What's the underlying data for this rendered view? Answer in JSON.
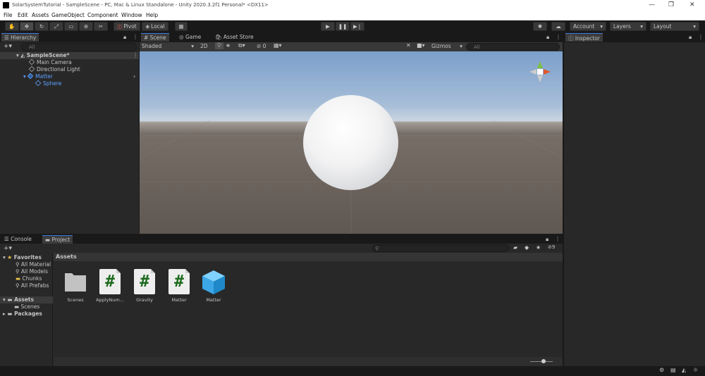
{
  "window": {
    "title": "SolarSystemTutorial - SampleScene - PC, Mac & Linux Standalone - Unity 2020.3.2f1 Personal* <DX11>",
    "minimize": "—",
    "maximize": "❐",
    "close": "✕"
  },
  "menu": [
    "File",
    "Edit",
    "Assets",
    "GameObject",
    "Component",
    "Window",
    "Help"
  ],
  "toolbar": {
    "pivot": "Pivot",
    "local": "Local",
    "account": "Account",
    "layers": "Layers",
    "layout": "Layout"
  },
  "hierarchy": {
    "tab": "Hierarchy",
    "search_placeholder": "All",
    "scene": "SampleScene*",
    "items": [
      "Main Camera",
      "Directional Light",
      "Matter",
      "Sphere"
    ]
  },
  "scene": {
    "tabs": [
      "Scene",
      "Game",
      "Asset Store"
    ],
    "shading": "Shaded",
    "mode_2d": "2D",
    "hidden_count": "0",
    "gizmos": "Gizmos",
    "search_placeholder": "All"
  },
  "inspector": {
    "tab": "Inspector"
  },
  "project": {
    "tabs": [
      "Console",
      "Project"
    ],
    "assets_header": "Assets",
    "badge_count": "9",
    "favorites": {
      "label": "Favorites",
      "items": [
        "All Material",
        "All Models",
        "Chunks",
        "All Prefabs"
      ]
    },
    "tree": {
      "assets": "Assets",
      "scenes": "Scenes",
      "packages": "Packages"
    },
    "items": [
      "Scenes",
      "ApplyNum...",
      "Gravity",
      "Matter",
      "Matter"
    ]
  },
  "colors": {
    "accent": "#3d7ae2",
    "background": "#191919",
    "panel": "#282828"
  }
}
